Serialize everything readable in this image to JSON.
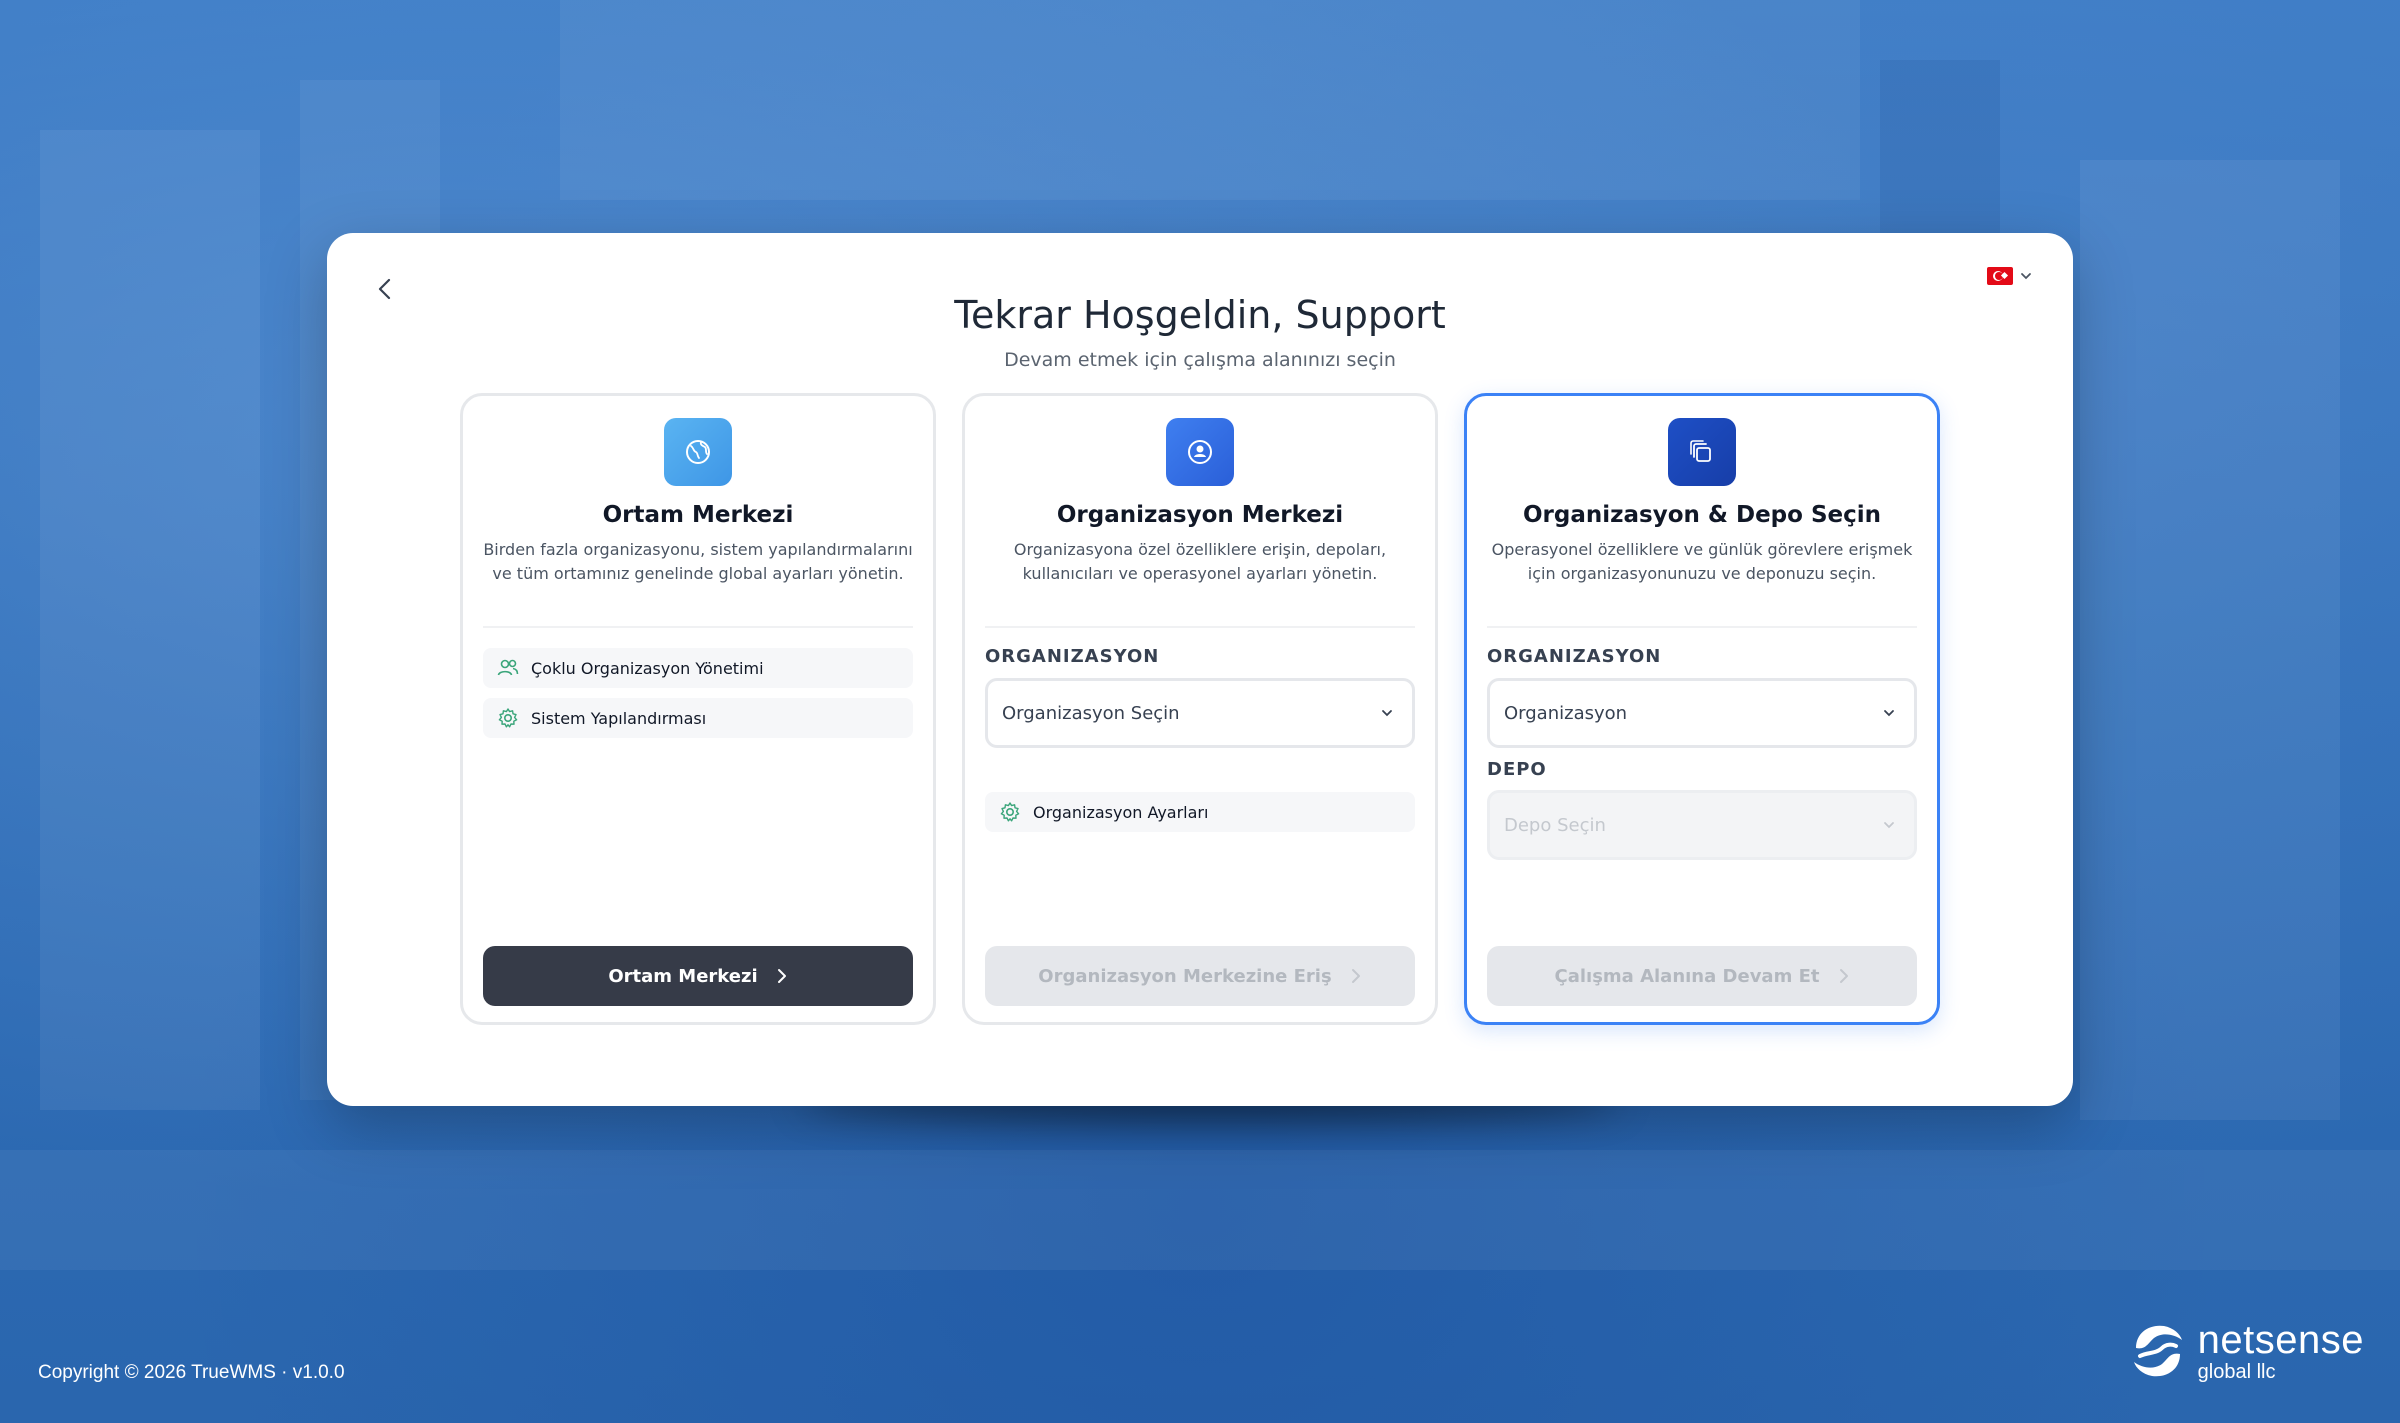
{
  "header": {
    "title": "Tekrar Hoşgeldin, Support",
    "subtitle": "Devam etmek için çalışma alanınızı seçin"
  },
  "language": {
    "icon": "turkish-flag-icon",
    "dropdown_icon": "chevron-down-icon"
  },
  "back": {
    "icon": "chevron-left-icon"
  },
  "cards": {
    "environment": {
      "icon": "globe-icon",
      "title": "Ortam Merkezi",
      "desc_line1": "Birden fazla organizasyonu, sistem yapılandırmalarını",
      "desc_line2": "ve tüm ortamınız genelinde global ayarları yönetin.",
      "features": [
        {
          "icon": "users-icon",
          "label": "Çoklu Organizasyon Yönetimi"
        },
        {
          "icon": "gear-icon",
          "label": "Sistem Yapılandırması"
        }
      ],
      "button": "Ortam Merkezi"
    },
    "organization": {
      "icon": "user-circle-icon",
      "title": "Organizasyon Merkezi",
      "desc_line1": "Organizasyona özel özelliklere erişin, depoları,",
      "desc_line2": "kullanıcıları ve operasyonel ayarları yönetin.",
      "field_label": "ORGANIZASYON",
      "select_placeholder": "Organizasyon Seçin",
      "features": [
        {
          "icon": "gear-icon",
          "label": "Organizasyon Ayarları"
        }
      ],
      "button": "Organizasyon Merkezine Eriş"
    },
    "workspace": {
      "icon": "layers-icon",
      "title": "Organizasyon & Depo Seçin",
      "desc_line1": "Operasyonel özelliklere ve günlük görevlere erişmek",
      "desc_line2": "için organizasyonunuzu ve deponuzu seçin.",
      "org_label": "ORGANIZASYON",
      "org_value": "Organizasyon",
      "depot_label": "DEPO",
      "depot_placeholder": "Depo Seçin",
      "button": "Çalışma Alanına Devam Et"
    }
  },
  "footer": {
    "copyright": "Copyright © 2026 TrueWMS · v1.0.0",
    "logo_main": "netsense",
    "logo_sub": "global llc"
  },
  "colors": {
    "background": "#2e6fba",
    "primary_button": "#363b48",
    "selected_border": "#3b82f6"
  }
}
